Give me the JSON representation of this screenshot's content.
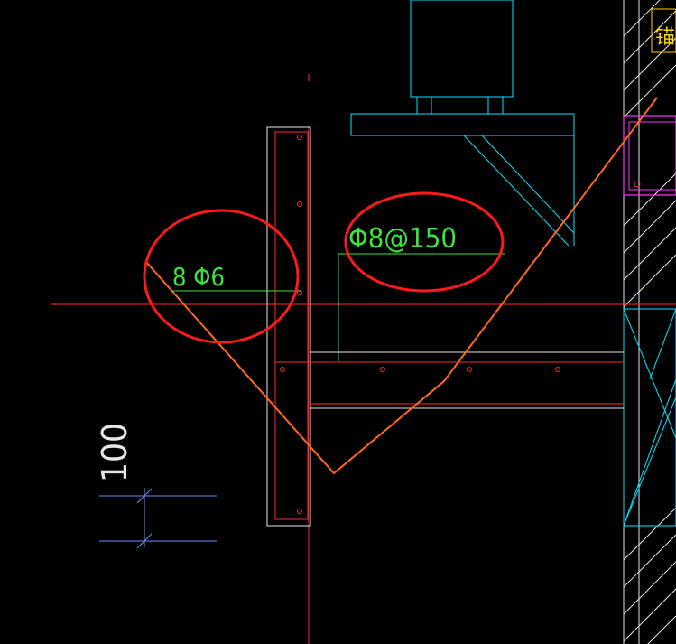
{
  "drawing": {
    "background": "#000000",
    "colors": {
      "cyan": "#00e5ff",
      "white": "#e6e6e6",
      "red": "#ff2a2a",
      "green": "#3ee23e",
      "orange": "#ff6a1a",
      "magenta": "#ff33ff",
      "blue": "#6f8cff",
      "yellow": "#ffd400",
      "highlight": "#ff1a1a"
    },
    "labels": {
      "rebar_corner": "8 Φ6",
      "rebar_spacing": "Φ8@150",
      "dimension": "100",
      "side_note": "锚"
    }
  }
}
